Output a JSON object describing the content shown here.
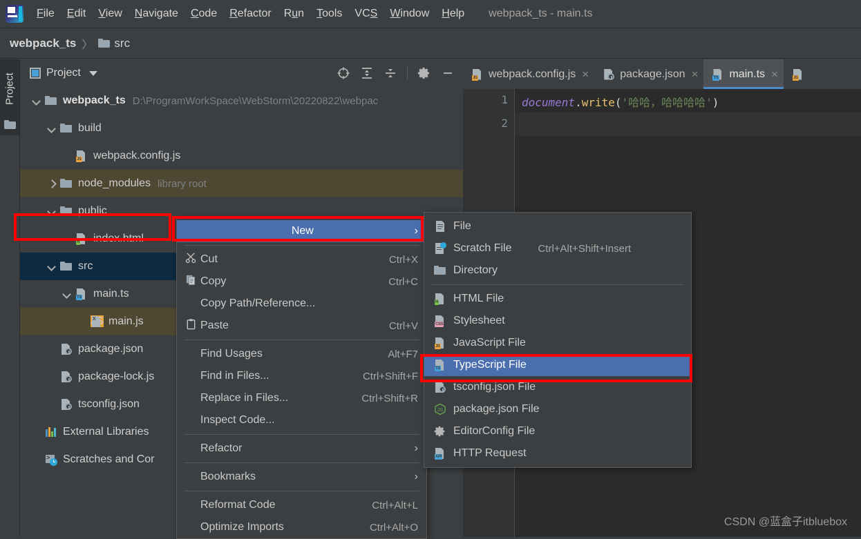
{
  "app": {
    "window_title": "webpack_ts - main.ts",
    "logo_name": "webstorm-logo"
  },
  "menubar": {
    "items": [
      {
        "label": "File",
        "accel": "F"
      },
      {
        "label": "Edit",
        "accel": "E"
      },
      {
        "label": "View",
        "accel": "V"
      },
      {
        "label": "Navigate",
        "accel": "N"
      },
      {
        "label": "Code",
        "accel": "C"
      },
      {
        "label": "Refactor",
        "accel": "R"
      },
      {
        "label": "Run",
        "accel": "u"
      },
      {
        "label": "Tools",
        "accel": "T"
      },
      {
        "label": "VCS",
        "accel": "S"
      },
      {
        "label": "Window",
        "accel": "W"
      },
      {
        "label": "Help",
        "accel": "H"
      }
    ]
  },
  "breadcrumb": {
    "items": [
      "webpack_ts",
      "src"
    ],
    "separator": "〉"
  },
  "toolwindow": {
    "vertical_label": "Project"
  },
  "project_panel": {
    "title": "Project",
    "toolbar_icons": [
      "locate-target-icon",
      "expand-all-icon",
      "collapse-all-icon",
      "gear-icon",
      "minimize-icon"
    ],
    "tree": [
      {
        "label": "webpack_ts",
        "hint": "D:\\ProgramWorkSpace\\WebStorm\\20220822\\webpac",
        "indent": 0,
        "chev": "down",
        "icon": "folder",
        "bold": true,
        "state": "normal"
      },
      {
        "label": "build",
        "hint": "",
        "indent": 1,
        "chev": "down",
        "icon": "folder",
        "bold": false,
        "state": "normal"
      },
      {
        "label": "webpack.config.js",
        "hint": "",
        "indent": 2,
        "chev": "none",
        "icon": "js",
        "bold": false,
        "state": "normal"
      },
      {
        "label": "node_modules",
        "hint": "library root",
        "indent": 1,
        "chev": "right",
        "icon": "folder",
        "bold": false,
        "state": "library"
      },
      {
        "label": "public",
        "hint": "",
        "indent": 1,
        "chev": "down",
        "icon": "folder",
        "bold": false,
        "state": "normal"
      },
      {
        "label": "index.html",
        "hint": "",
        "indent": 2,
        "chev": "none",
        "icon": "html",
        "bold": false,
        "state": "normal"
      },
      {
        "label": "src",
        "hint": "",
        "indent": 1,
        "chev": "down",
        "icon": "folder",
        "bold": false,
        "state": "selected"
      },
      {
        "label": "main.ts",
        "hint": "",
        "indent": 2,
        "chev": "down",
        "icon": "ts",
        "bold": false,
        "state": "normal"
      },
      {
        "label": "main.js",
        "hint": "",
        "indent": 3,
        "chev": "none",
        "icon": "xls-js",
        "bold": false,
        "state": "library"
      },
      {
        "label": "package.json",
        "hint": "",
        "indent": 1,
        "chev": "none",
        "icon": "json",
        "bold": false,
        "state": "normal"
      },
      {
        "label": "package-lock.js",
        "hint": "",
        "indent": 1,
        "chev": "none",
        "icon": "json",
        "bold": false,
        "state": "normal"
      },
      {
        "label": "tsconfig.json",
        "hint": "",
        "indent": 1,
        "chev": "none",
        "icon": "json",
        "bold": false,
        "state": "normal"
      },
      {
        "label": "External Libraries",
        "hint": "",
        "indent": 0,
        "chev": "none",
        "icon": "bars",
        "bold": false,
        "state": "normal"
      },
      {
        "label": "Scratches and Cor",
        "hint": "",
        "indent": 0,
        "chev": "none",
        "icon": "scratch",
        "bold": false,
        "state": "normal"
      }
    ]
  },
  "editor": {
    "tabs": [
      {
        "label": "webpack.config.js",
        "icon": "js",
        "active": false,
        "close": "×"
      },
      {
        "label": "package.json",
        "icon": "json",
        "active": false,
        "close": "×"
      },
      {
        "label": "main.ts",
        "icon": "ts",
        "active": true,
        "close": "×"
      },
      {
        "label": "",
        "icon": "js",
        "active": false,
        "close": ""
      }
    ],
    "line_numbers": [
      "1",
      "2"
    ],
    "code_line": {
      "ident": "document",
      "dot": ".",
      "fn": "write",
      "open": "(",
      "string": "'哈哈，哈哈哈哈'",
      "close": ")"
    }
  },
  "context_menu": {
    "items": [
      {
        "label": "New",
        "key": "",
        "icon": "",
        "arrow": "›",
        "highlight": true,
        "accel": ""
      },
      {
        "sep": true
      },
      {
        "label": "Cut",
        "key": "Ctrl+X",
        "icon": "scissors-icon",
        "arrow": "",
        "accel": "t"
      },
      {
        "label": "Copy",
        "key": "Ctrl+C",
        "icon": "copy-icon",
        "arrow": "",
        "accel": "C"
      },
      {
        "label": "Copy Path/Reference...",
        "key": "",
        "icon": "",
        "arrow": "",
        "accel": ""
      },
      {
        "label": "Paste",
        "key": "Ctrl+V",
        "icon": "paste-icon",
        "arrow": "",
        "accel": "P"
      },
      {
        "sep": true
      },
      {
        "label": "Find Usages",
        "key": "Alt+F7",
        "icon": "",
        "arrow": "",
        "accel": "U"
      },
      {
        "label": "Find in Files...",
        "key": "Ctrl+Shift+F",
        "icon": "",
        "arrow": "",
        "accel": ""
      },
      {
        "label": "Replace in Files...",
        "key": "Ctrl+Shift+R",
        "icon": "",
        "arrow": "",
        "accel": "a"
      },
      {
        "label": "Inspect Code...",
        "key": "",
        "icon": "",
        "arrow": "",
        "accel": "I"
      },
      {
        "sep": true
      },
      {
        "label": "Refactor",
        "key": "",
        "icon": "",
        "arrow": "›",
        "accel": "R"
      },
      {
        "sep": true
      },
      {
        "label": "Bookmarks",
        "key": "",
        "icon": "",
        "arrow": "›",
        "accel": ""
      },
      {
        "sep": true
      },
      {
        "label": "Reformat Code",
        "key": "Ctrl+Alt+L",
        "icon": "",
        "arrow": "",
        "accel": "R"
      },
      {
        "label": "Optimize Imports",
        "key": "Ctrl+Alt+O",
        "icon": "",
        "arrow": "",
        "accel": "O"
      }
    ]
  },
  "new_submenu": {
    "items": [
      {
        "label": "File",
        "key": "",
        "icon": "file-icon",
        "highlight": false
      },
      {
        "label": "Scratch File",
        "key": "Ctrl+Alt+Shift+Insert",
        "icon": "scratch-file-icon",
        "highlight": false
      },
      {
        "label": "Directory",
        "key": "",
        "icon": "folder-icon",
        "highlight": false
      },
      {
        "sep": true
      },
      {
        "label": "HTML File",
        "key": "",
        "icon": "html-file-icon",
        "highlight": false
      },
      {
        "label": "Stylesheet",
        "key": "",
        "icon": "css-file-icon",
        "highlight": false
      },
      {
        "label": "JavaScript File",
        "key": "",
        "icon": "js-file-icon",
        "highlight": false
      },
      {
        "label": "TypeScript File",
        "key": "",
        "icon": "ts-file-icon",
        "highlight": true
      },
      {
        "label": "tsconfig.json File",
        "key": "",
        "icon": "json-file-icon",
        "highlight": false
      },
      {
        "label": "package.json File",
        "key": "",
        "icon": "node-icon",
        "highlight": false
      },
      {
        "label": "EditorConfig File",
        "key": "",
        "icon": "gear-icon",
        "highlight": false
      },
      {
        "label": "HTTP Request",
        "key": "",
        "icon": "http-file-icon",
        "highlight": false
      }
    ]
  },
  "annotations": {
    "watermark": "CSDN @蓝盒子itbluebox",
    "highlight_color": "#ff0000"
  }
}
